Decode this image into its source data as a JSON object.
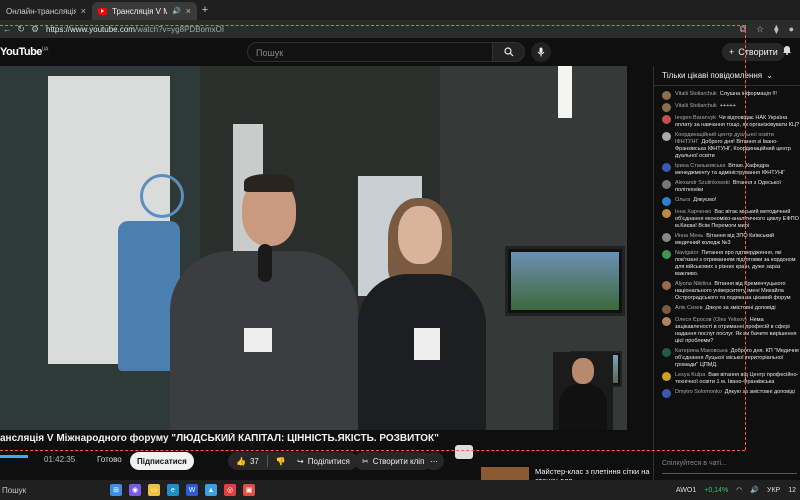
{
  "browser": {
    "tabs": [
      {
        "label": "Онлайн-трансляція V Міжна",
        "active": false
      },
      {
        "label": "Трансляція V Міжнародн",
        "active": true
      }
    ],
    "url_host": "https://www.youtube.com",
    "url_path": "/watch?v=yg8PDBomxOI"
  },
  "youtube": {
    "logo": "YouTube",
    "logo_region": "UA",
    "search_placeholder": "Пошук",
    "create_label": "Створити"
  },
  "video": {
    "title": "ансляція V Міжнародного форуму \"ЛЮДСЬКИЙ КАПІТАЛ: ЦІННІСТЬ.ЯКІСТЬ. РОЗВИТОК\"",
    "elapsed": "01:42:35",
    "ready_label": "Готово",
    "subscribe_label": "Підписатися",
    "likes": "37",
    "share_label": "Поділитися",
    "clip_label": "Створити кліп",
    "progress_fraction": 0.04
  },
  "chat": {
    "header": "Тільки цікаві повідомлення",
    "input_placeholder": "Спілкуйтеся в чаті...",
    "messages": [
      {
        "author": "Vitalii Stoliarchuk",
        "text": "Слушна інформація !!!",
        "color": "#8a6f4a"
      },
      {
        "author": "Vitalii Stoliarchuk",
        "text": "+++++",
        "color": "#8a6f4a"
      },
      {
        "author": "Ievgen Baranvyk",
        "text": "Чи відповідає НАК Україна оплату за навчання тощо, як організовувати КЦ?",
        "color": "#c05050"
      },
      {
        "author": "Координаційний центр дуальної освіти ІФНТУНГ",
        "text": "Доброго дня! Вітання зі Івано-Франківська ІФНТУНГ, Координаційний центр дуальної освіти",
        "color": "#aaaaaa"
      },
      {
        "author": "Ірина Станьковська",
        "text": "Вітаю. Кафедра менеджменту та адміністрування ІФНТУНГ",
        "color": "#3a5ab0"
      },
      {
        "author": "Alexandr Szulinkowski",
        "text": "Вітання з Одеської політехніки",
        "color": "#777777"
      },
      {
        "author": "Ольга",
        "text": "Дякуємо!",
        "color": "#2f7fd0"
      },
      {
        "author": "Інна Харченко",
        "text": "Вас вітає міський методичний об'єднання економіко-аналітичного циклу ЕФПО м.Києва! Всім Перемоги мирі",
        "color": "#c08a3a"
      },
      {
        "author": "Инна Мень",
        "text": "Вітання від ЗПО Київський медичний коледж №3",
        "color": "#888888"
      },
      {
        "author": "Navigator",
        "text": "Питання про пдтвердження, які пов'язані з отриманням підготовки за кордоном для військових з різних країн, дуже зараз важливо.",
        "color": "#3a9a4a"
      },
      {
        "author": "Alyona Nikitina",
        "text": "Вітання від Кременчуцького національного університету імені Михайла Остроградського та подяка за цікавий форум",
        "color": "#9a6a4a"
      },
      {
        "author": "Алік Сизов",
        "text": "Дякую за змістовні доповіді",
        "color": "#7a5a40"
      },
      {
        "author": "Олеся Єросов (Oles Yelisov)",
        "text": "Нема зацікавленості в отриманні професій в сфері надання послуг послуг. Як ви бачите вирішення цієї проблеми?",
        "color": "#aa8866"
      },
      {
        "author": "Катерина Маковська",
        "text": "Доброго дня. КП \"Медичне об'єднання Луцької міської територіальної громади\" ЦПМД.",
        "color": "#1f5a4a"
      },
      {
        "author": "Lesya Kulpa",
        "text": "Вам вітання від Центр професійно-технічної освіти 1 м. Івано-Франківська",
        "color": "#d0a020"
      },
      {
        "author": "Dmytro Solomonko",
        "text": "Дякую за змістовні доповіді",
        "color": "#3a5ab0"
      }
    ]
  },
  "recommendation": {
    "title": "Майстер-клас з плетіння сітки на станку для"
  },
  "taskbar": {
    "search_label": "Пошук",
    "ticker_symbol": "AWO1",
    "ticker_change": "+0,14%",
    "lang": "УКР",
    "clock": "12"
  }
}
